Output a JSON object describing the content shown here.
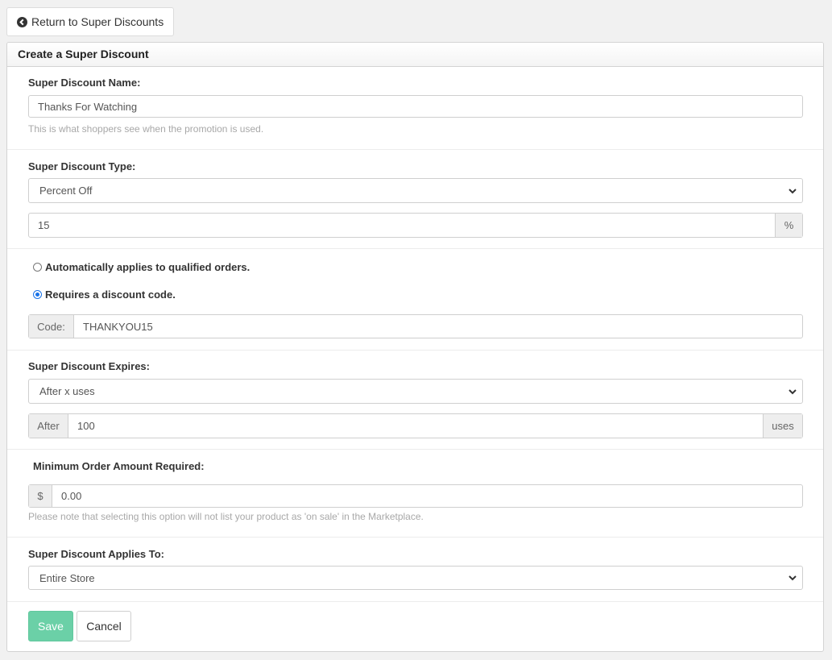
{
  "back_button": {
    "label": "Return to Super Discounts",
    "icon": "chevron-circle-left-icon"
  },
  "panel": {
    "title": "Create a Super Discount"
  },
  "name_section": {
    "label": "Super Discount Name:",
    "value": "Thanks For Watching",
    "help": "This is what shoppers see when the promotion is used."
  },
  "type_section": {
    "label": "Super Discount Type:",
    "selected": "Percent Off",
    "amount": "15",
    "amount_suffix": "%"
  },
  "apply_section": {
    "auto_label": "Automatically applies to qualified orders.",
    "auto_checked": false,
    "code_label": "Requires a discount code.",
    "code_checked": true,
    "code_prefix": "Code:",
    "code_value": "THANKYOU15"
  },
  "expires_section": {
    "label": "Super Discount Expires:",
    "selected": "After x uses",
    "prefix": "After",
    "uses": "100",
    "suffix": "uses"
  },
  "minimum_section": {
    "label": "Minimum Order Amount Required:",
    "prefix": "$",
    "value": "0.00",
    "help": "Please note that selecting this option will not list your product as 'on sale' in the Marketplace."
  },
  "applies_section": {
    "label": "Super Discount Applies To:",
    "selected": "Entire Store"
  },
  "actions": {
    "save_label": "Save",
    "cancel_label": "Cancel"
  },
  "colors": {
    "save": "#6bd0a7",
    "radio_accent": "#1a73e8",
    "background": "#f1f1f1"
  }
}
